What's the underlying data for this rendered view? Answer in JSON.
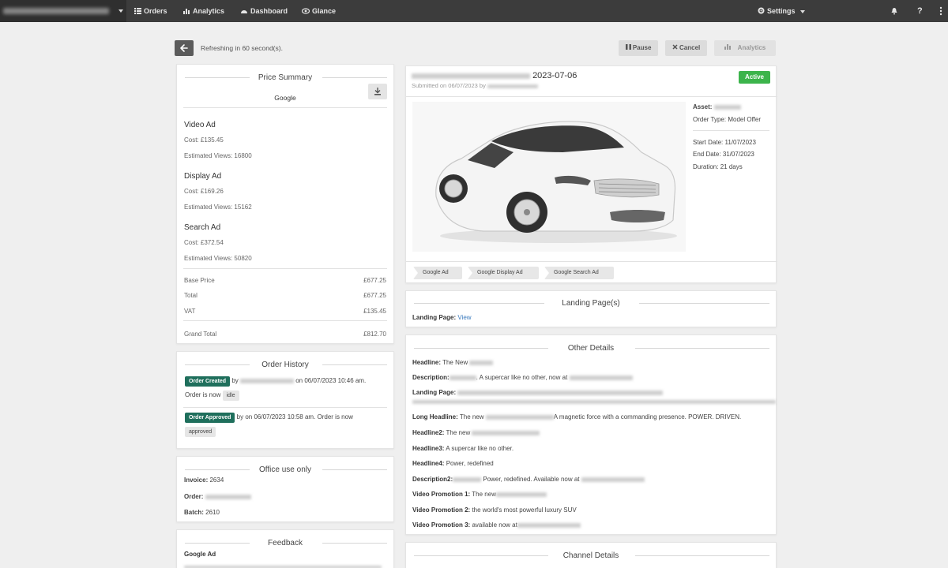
{
  "topbar": {
    "nav": [
      {
        "label": "Orders",
        "icon": "list-icon"
      },
      {
        "label": "Analytics",
        "icon": "bar-chart-icon"
      },
      {
        "label": "Dashboard",
        "icon": "dashboard-icon"
      },
      {
        "label": "Glance",
        "icon": "eye-icon"
      }
    ],
    "settings_label": "Settings",
    "help_label": "?"
  },
  "header": {
    "refresh_text": "Refreshing in 60 second(s).",
    "pause_label": "Pause",
    "cancel_label": "Cancel",
    "analytics_label": "Analytics"
  },
  "price_summary": {
    "title": "Price Summary",
    "provider": "Google",
    "items": [
      {
        "name": "Video Ad",
        "cost": "Cost: £135.45",
        "views": "Estimated Views: 16800"
      },
      {
        "name": "Display Ad",
        "cost": "Cost: £169.26",
        "views": "Estimated Views: 15162"
      },
      {
        "name": "Search Ad",
        "cost": "Cost: £372.54",
        "views": "Estimated Views: 50820"
      }
    ],
    "totals": [
      {
        "label": "Base Price",
        "value": "£677.25"
      },
      {
        "label": "Total",
        "value": "£677.25"
      },
      {
        "label": "VAT",
        "value": "£135.45"
      }
    ],
    "grand_total_label": "Grand Total",
    "grand_total_value": "£812.70"
  },
  "order_history": {
    "title": "Order History",
    "entry1": {
      "badge": "Order Created",
      "by": "by",
      "text": "on 06/07/2023 10:46 am.",
      "status_prefix": "Order is now",
      "status": "idle"
    },
    "entry2": {
      "badge": "Order Approved",
      "text": "by on 06/07/2023 10:58 am. Order is now",
      "status": "approved"
    }
  },
  "office": {
    "title": "Office use only",
    "invoice_label": "Invoice:",
    "invoice_value": "2634",
    "order_label": "Order:",
    "batch_label": "Batch:",
    "batch_value": "2610"
  },
  "feedback": {
    "title": "Feedback",
    "item": "Google Ad"
  },
  "order_card": {
    "title_date": "2023-07-06",
    "submitted": "Submitted on 06/07/2023 by",
    "status": "Active",
    "asset_label": "Asset:",
    "order_type_label": "Order Type:",
    "order_type": "Model Offer",
    "start_label": "Start Date:",
    "start": "11/07/2023",
    "end_label": "End Date:",
    "end": "31/07/2023",
    "duration_label": "Duration:",
    "duration": "21 days",
    "tags": [
      "Google Ad",
      "Google Display Ad",
      "Google Search Ad"
    ]
  },
  "landing": {
    "title": "Landing Page(s)",
    "label": "Landing Page:",
    "link": "View"
  },
  "other_details": {
    "title": "Other Details",
    "headline_label": "Headline:",
    "headline": "The New",
    "description_label": "Description:",
    "description": ". A supercar like no other, now at",
    "landing_label": "Landing Page:",
    "long_headline_label": "Long Headline:",
    "long_headline_a": "The new",
    "long_headline_b": "A magnetic force with a commanding presence. POWER. DRIVEN.",
    "headline2_label": "Headline2:",
    "headline2": "The new",
    "headline3_label": "Headline3:",
    "headline3": "A supercar like no other.",
    "headline4_label": "Headline4:",
    "headline4": "Power, redefined",
    "description2_label": "Description2:",
    "description2": "Power, redefined. Available now at",
    "vp1_label": "Video Promotion 1:",
    "vp1": "The new",
    "vp2_label": "Video Promotion 2:",
    "vp2": "the world's most powerful luxury SUV",
    "vp3_label": "Video Promotion 3:",
    "vp3": "available now at"
  },
  "channel": {
    "title": "Channel Details"
  },
  "colors": {
    "topbar": "#3c3c3c",
    "active_badge": "#3cb44b",
    "history_badge": "#1f6f5c",
    "link": "#3a7abd"
  }
}
